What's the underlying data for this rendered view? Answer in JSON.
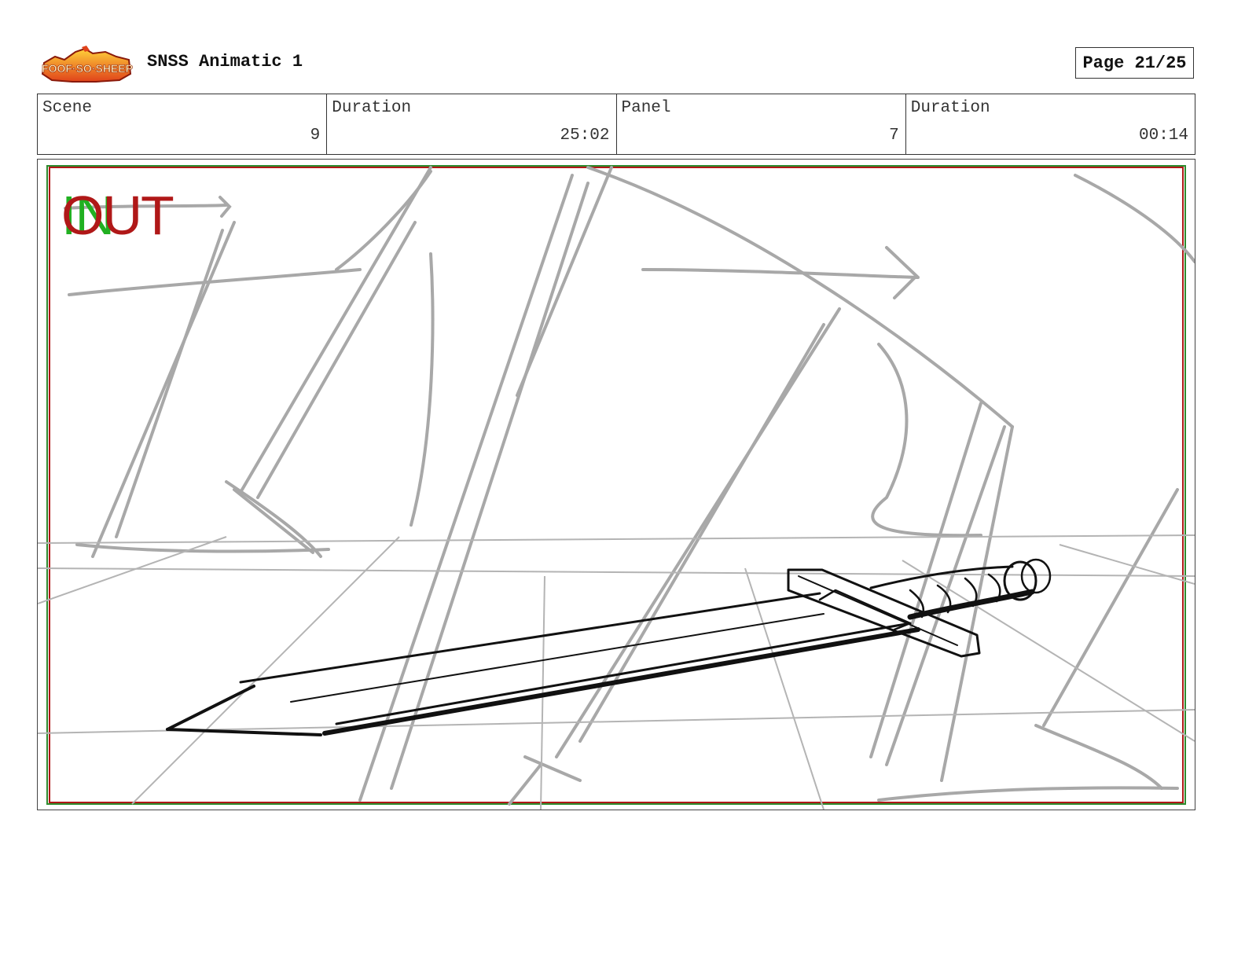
{
  "header": {
    "logo_text": "Sir Foof-So-Sheep",
    "title": "SNSS Animatic 1",
    "page_label": "Page 21/25"
  },
  "info": {
    "scene_label": "Scene",
    "scene_value": "9",
    "scene_duration_label": "Duration",
    "scene_duration_value": "25:02",
    "panel_label": "Panel",
    "panel_value": "7",
    "panel_duration_label": "Duration",
    "panel_duration_value": "00:14"
  },
  "panel": {
    "in_label": "IN",
    "out_label": "OUT",
    "frame_color_outer": "#2e8b2e",
    "frame_color_inner": "#b01818",
    "sketch_color": "#a8a8a8",
    "ink_color": "#111111",
    "subject_icon": "sword-sketch"
  }
}
